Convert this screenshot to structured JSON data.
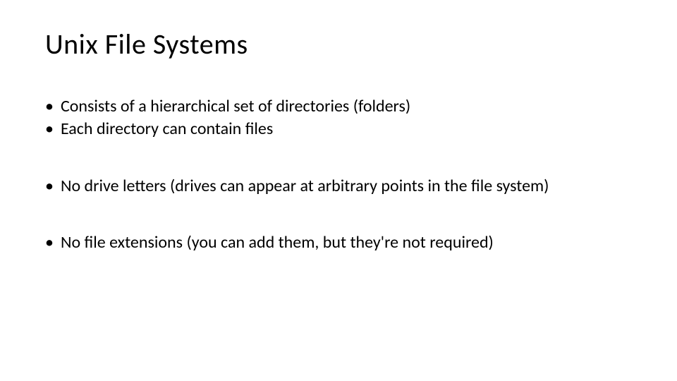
{
  "slide": {
    "title": "Unix File Systems",
    "bullets": [
      {
        "text": "Consists of a hierarchical set of directories (folders)"
      },
      {
        "text": "Each directory can contain files"
      },
      {
        "text": "No drive letters (drives can appear at arbitrary points in the file system)"
      },
      {
        "text": "No file extensions (you can add them, but they're not required)"
      }
    ]
  }
}
